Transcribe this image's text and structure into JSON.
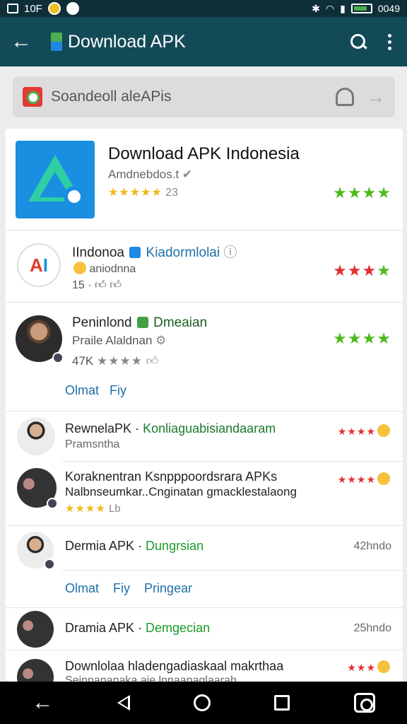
{
  "status": {
    "left_text": "10F",
    "right_text": "0049"
  },
  "app_bar": {
    "title": "Download APK"
  },
  "search": {
    "value": "Soandeoll aleAPis"
  },
  "colors": {
    "header": "#134a57",
    "accent_green": "#4cba1c",
    "accent_red": "#e32f2f",
    "link_blue": "#1e6fa8"
  },
  "items": {
    "featured": {
      "title": "Download APK Indonesia",
      "subtitle": "Amdnebdos.t",
      "rating_stars": "★★★★★",
      "rating_count": "23",
      "right_stars": "★★★★"
    },
    "indonoa": {
      "name": "IIndonoa",
      "tag": "Kiadormlolai",
      "sub": "aniodnna",
      "meta": "15 ·",
      "stars_red": "★★★",
      "stars_green": "★"
    },
    "pennond": {
      "name": "Peninlond",
      "tag": "Dmeaian",
      "sub": "Praile Alaldnan",
      "meta": "47K",
      "meta_stars": "★★★★",
      "right_stars": "★★★★",
      "link1": "Olmat",
      "link2": "Fiy"
    },
    "comment1": {
      "line1": "RewnelaPK",
      "line1_tag": "Konliaguabisiandaaram",
      "line2": "Pramsntha",
      "stars": "★★★★"
    },
    "comment2": {
      "line1": "Koraknentran Ksnpppoordsrara APKs",
      "line2": "Nalbnseumkar..Cnginatan gmacklestalaong",
      "line3_stars": "★★★★",
      "line3_text": "Lb",
      "stars": "★★★★"
    },
    "dermia": {
      "name": "Dermia APK",
      "tag": "Dungrsian",
      "time": "42hndo",
      "link1": "Olmat",
      "link2": "Fiy",
      "link3": "Pringear"
    },
    "dramia": {
      "name": "Dramia APK",
      "tag": "Demgecian",
      "time": "25hndo"
    },
    "downloaa": {
      "line1": "Downlolaa hladengadiaskaal makrthaa",
      "line2": "Seinnananaka aie lnnaanaglaarah",
      "stars": "★★★"
    }
  }
}
